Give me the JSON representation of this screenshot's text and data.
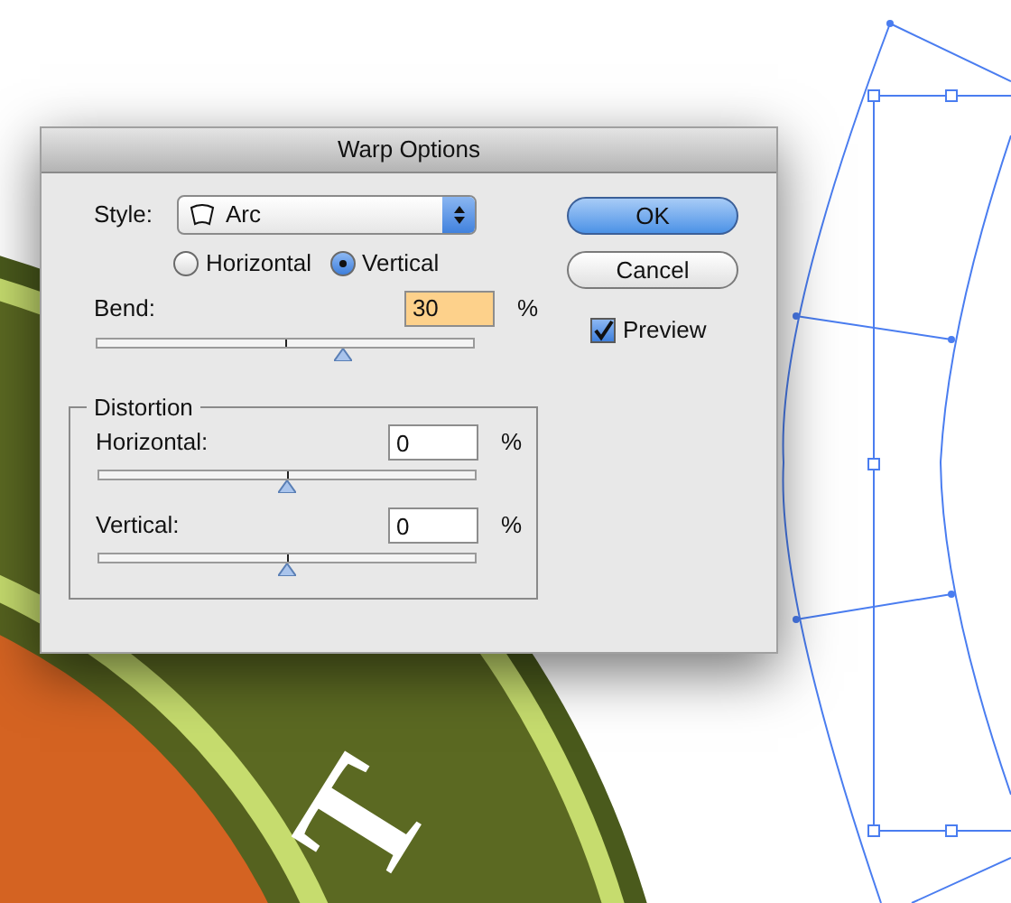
{
  "dialog": {
    "title": "Warp Options",
    "style": {
      "label": "Style:",
      "value": "Arc"
    },
    "orientation": [
      {
        "label": "Horizontal",
        "selected": false
      },
      {
        "label": "Vertical",
        "selected": true
      }
    ],
    "bend": {
      "label": "Bend:",
      "value": "30",
      "unit": "%",
      "focused": true,
      "level": 0.65
    },
    "distortion": {
      "title": "Distortion",
      "fields": [
        {
          "label": "Horizontal:",
          "value": "0",
          "unit": "%",
          "focused": false,
          "level": 0.5
        },
        {
          "label": "Vertical:",
          "value": "0",
          "unit": "%",
          "focused": false,
          "level": 0.5
        }
      ]
    },
    "buttons": [
      {
        "label": "OK",
        "default": true
      },
      {
        "label": "Cancel",
        "default": false
      }
    ],
    "preview": {
      "label": "Preview",
      "checked": true
    }
  },
  "artwork": {
    "letters": [
      "T"
    ]
  }
}
